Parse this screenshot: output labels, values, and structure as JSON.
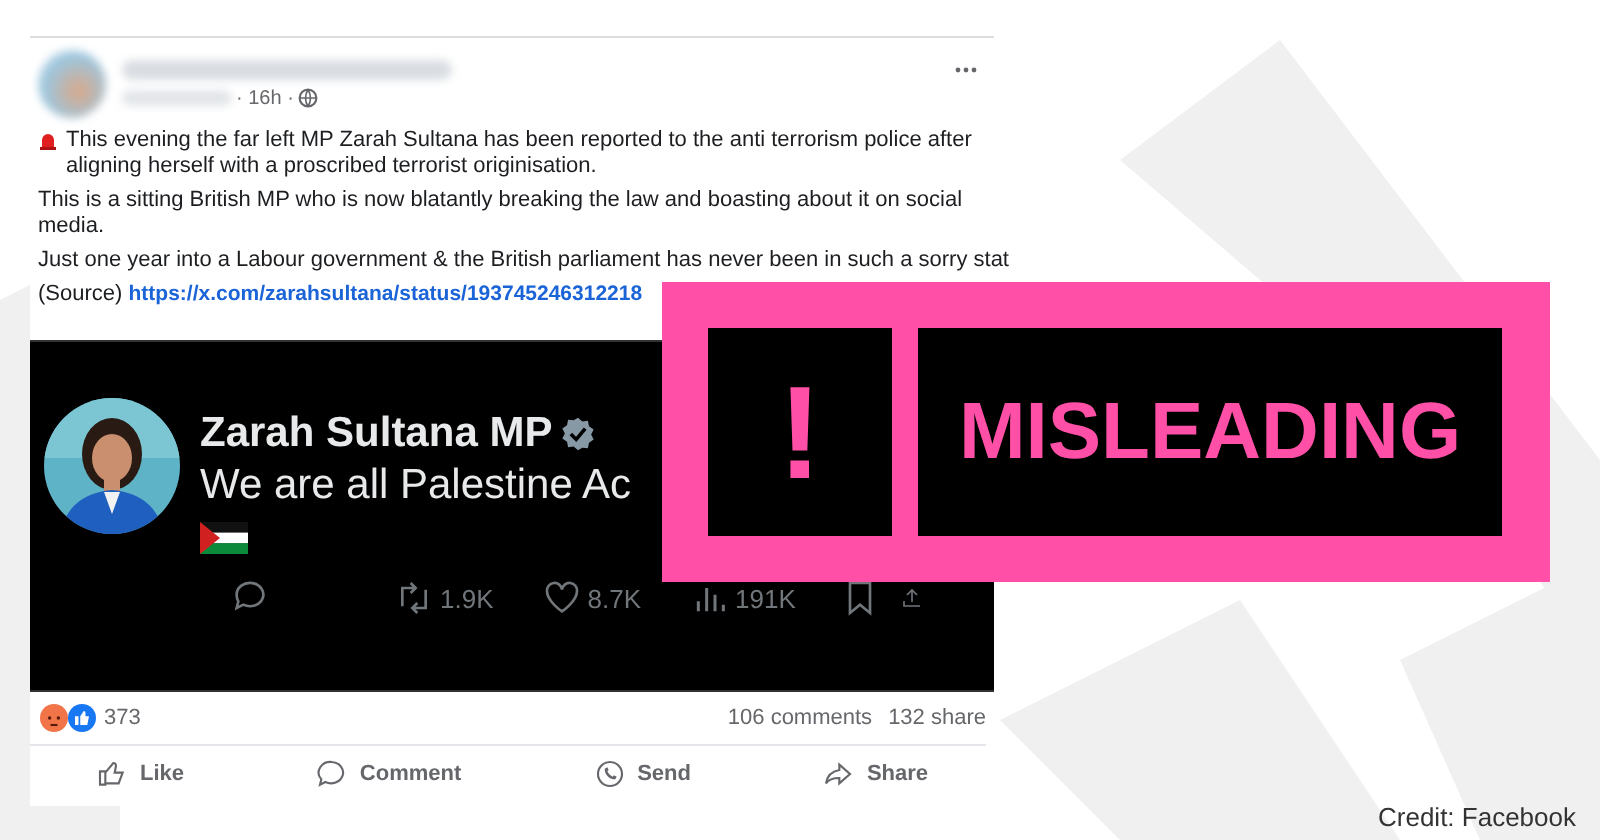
{
  "post": {
    "time": "· 16h ·",
    "paragraphs": [
      {
        "kind": "alert",
        "text": "This evening the far left MP Zarah Sultana has been reported to the anti terrorism police after aligning herself with a proscribed terrorist originisation."
      },
      {
        "kind": "plain",
        "text": "This is a sitting British MP who is now blatantly breaking the law and boasting about it on social media."
      },
      {
        "kind": "plain",
        "text": "Just one year into a Labour government & the British parliament has never been in such a sorry stat"
      }
    ],
    "source_label": "(Source)",
    "source_link": "https://x.com/zarahsultana/status/193745246312218",
    "embed": {
      "name": "Zarah Sultana MP",
      "text": "We are all Palestine Ac",
      "stats": [
        {
          "kind": "reply"
        },
        {
          "kind": "repost",
          "count": "1.9K"
        },
        {
          "kind": "like",
          "count": "8.7K"
        },
        {
          "kind": "views",
          "count": "191K"
        },
        {
          "kind": "bookmark"
        },
        {
          "kind": "share"
        }
      ]
    },
    "reactions_count": "373",
    "comments": "106 comments",
    "shares": "132 share",
    "actions": [
      {
        "kind": "like",
        "label": "Like"
      },
      {
        "kind": "comment",
        "label": "Comment"
      },
      {
        "kind": "send",
        "label": "Send"
      },
      {
        "kind": "share",
        "label": "Share"
      }
    ]
  },
  "verdict": {
    "mark": "!",
    "label": "MISLEADING"
  },
  "credit": "Credit: Facebook"
}
